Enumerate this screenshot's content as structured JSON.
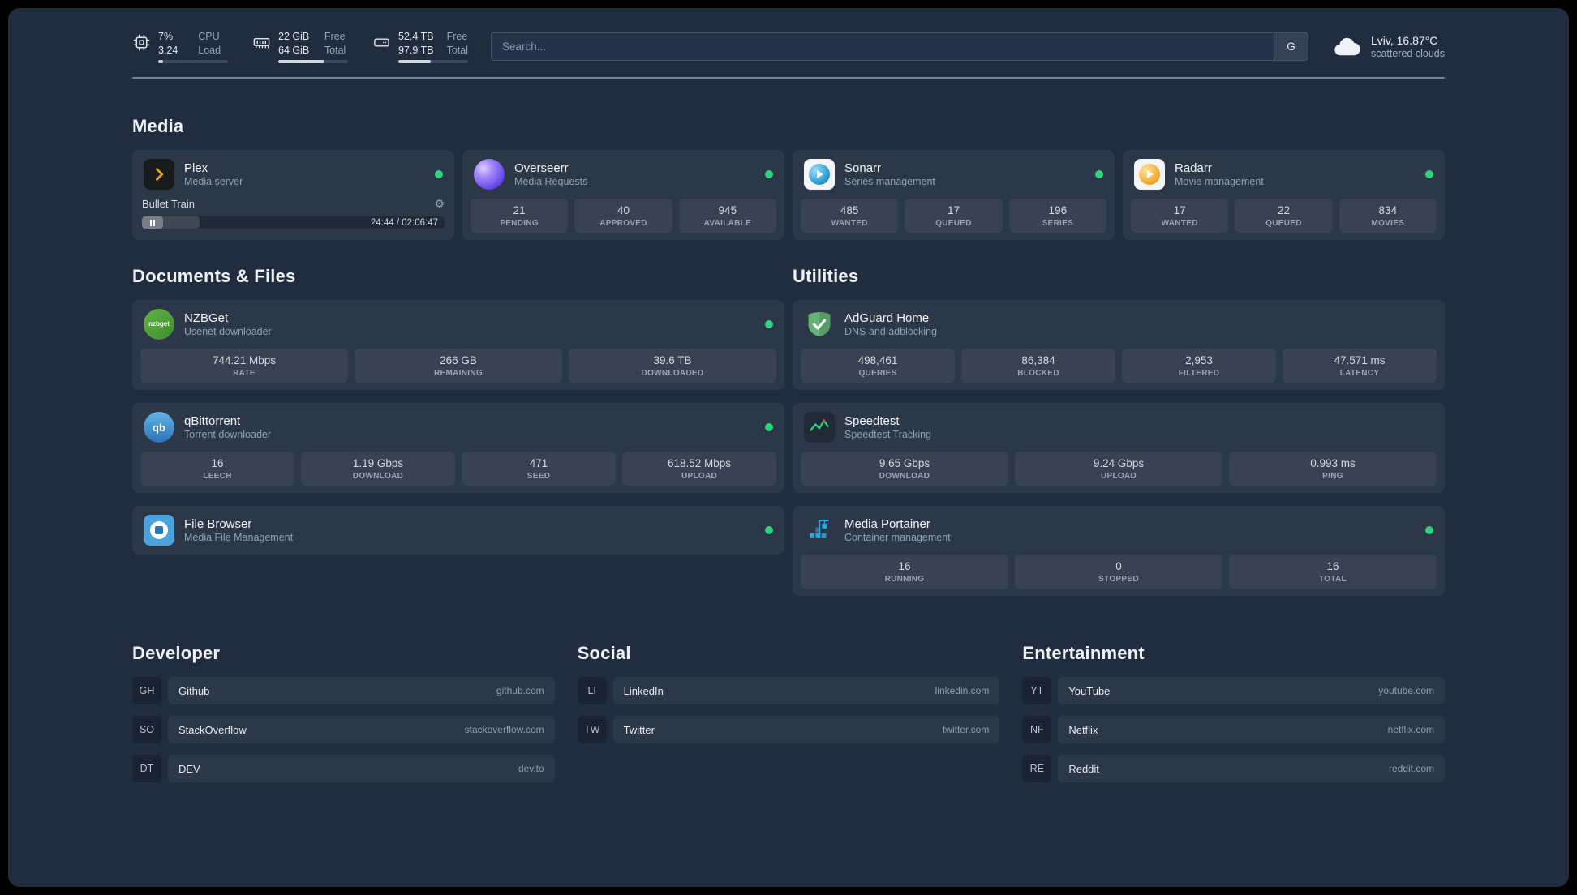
{
  "topbar": {
    "cpu": {
      "value1": "7%",
      "label1": "CPU",
      "value2": "3.24",
      "label2": "Load",
      "bar_style": "width:7%"
    },
    "memory": {
      "value1": "22 GiB",
      "label1": "Free",
      "value2": "64 GiB",
      "label2": "Total",
      "bar_style": "width:66%"
    },
    "disk": {
      "value1": "52.4 TB",
      "label1": "Free",
      "value2": "97.9 TB",
      "label2": "Total",
      "bar_style": "width:47%"
    },
    "search": {
      "placeholder": "Search...",
      "button_label": "G"
    },
    "weather": {
      "location": "Lviv, 16.87°C",
      "condition": "scattered clouds"
    }
  },
  "media": {
    "heading": "Media",
    "plex": {
      "name": "Plex",
      "desc": "Media server",
      "now_playing": "Bullet Train",
      "time": "24:44 / 02:06:47",
      "progress_style": "width:19%"
    },
    "overseerr": {
      "name": "Overseerr",
      "desc": "Media Requests",
      "stats": [
        {
          "value": "21",
          "label": "PENDING"
        },
        {
          "value": "40",
          "label": "APPROVED"
        },
        {
          "value": "945",
          "label": "AVAILABLE"
        }
      ]
    },
    "sonarr": {
      "name": "Sonarr",
      "desc": "Series management",
      "stats": [
        {
          "value": "485",
          "label": "WANTED"
        },
        {
          "value": "17",
          "label": "QUEUED"
        },
        {
          "value": "196",
          "label": "SERIES"
        }
      ]
    },
    "radarr": {
      "name": "Radarr",
      "desc": "Movie management",
      "stats": [
        {
          "value": "17",
          "label": "WANTED"
        },
        {
          "value": "22",
          "label": "QUEUED"
        },
        {
          "value": "834",
          "label": "MOVIES"
        }
      ]
    }
  },
  "documents": {
    "heading": "Documents & Files",
    "nzbget": {
      "name": "NZBGet",
      "desc": "Usenet downloader",
      "stats": [
        {
          "value": "744.21 Mbps",
          "label": "RATE"
        },
        {
          "value": "266 GB",
          "label": "REMAINING"
        },
        {
          "value": "39.6 TB",
          "label": "DOWNLOADED"
        }
      ]
    },
    "qbittorrent": {
      "name": "qBittorrent",
      "desc": "Torrent downloader",
      "stats": [
        {
          "value": "16",
          "label": "LEECH"
        },
        {
          "value": "1.19 Gbps",
          "label": "DOWNLOAD"
        },
        {
          "value": "471",
          "label": "SEED"
        },
        {
          "value": "618.52 Mbps",
          "label": "UPLOAD"
        }
      ]
    },
    "filebrowser": {
      "name": "File Browser",
      "desc": "Media File Management"
    }
  },
  "utilities": {
    "heading": "Utilities",
    "adguard": {
      "name": "AdGuard Home",
      "desc": "DNS and adblocking",
      "stats": [
        {
          "value": "498,461",
          "label": "QUERIES"
        },
        {
          "value": "86,384",
          "label": "BLOCKED"
        },
        {
          "value": "2,953",
          "label": "FILTERED"
        },
        {
          "value": "47.571 ms",
          "label": "LATENCY"
        }
      ]
    },
    "speedtest": {
      "name": "Speedtest",
      "desc": "Speedtest Tracking",
      "stats": [
        {
          "value": "9.65 Gbps",
          "label": "DOWNLOAD"
        },
        {
          "value": "9.24 Gbps",
          "label": "UPLOAD"
        },
        {
          "value": "0.993 ms",
          "label": "PING"
        }
      ]
    },
    "portainer": {
      "name": "Media Portainer",
      "desc": "Container management",
      "stats": [
        {
          "value": "16",
          "label": "RUNNING"
        },
        {
          "value": "0",
          "label": "STOPPED"
        },
        {
          "value": "16",
          "label": "TOTAL"
        }
      ]
    }
  },
  "bookmarks": {
    "developer": {
      "heading": "Developer",
      "items": [
        {
          "abbr": "GH",
          "name": "Github",
          "domain": "github.com"
        },
        {
          "abbr": "SO",
          "name": "StackOverflow",
          "domain": "stackoverflow.com"
        },
        {
          "abbr": "DT",
          "name": "DEV",
          "domain": "dev.to"
        }
      ]
    },
    "social": {
      "heading": "Social",
      "items": [
        {
          "abbr": "LI",
          "name": "LinkedIn",
          "domain": "linkedin.com"
        },
        {
          "abbr": "TW",
          "name": "Twitter",
          "domain": "twitter.com"
        }
      ]
    },
    "entertainment": {
      "heading": "Entertainment",
      "items": [
        {
          "abbr": "YT",
          "name": "YouTube",
          "domain": "youtube.com"
        },
        {
          "abbr": "NF",
          "name": "Netflix",
          "domain": "netflix.com"
        },
        {
          "abbr": "RE",
          "name": "Reddit",
          "domain": "reddit.com"
        }
      ]
    }
  },
  "icons": {
    "nzbget_label": "nzbget",
    "qbittorrent_label": "qb"
  },
  "colors": {
    "status_ok": "#2dd47e",
    "plex": "#e5a00d",
    "overseerr": "#6246ea",
    "sonarr": "#2596cf",
    "radarr": "#f0a52a",
    "nzbget": "#53a93e",
    "qbittorrent": "#3c86c8",
    "filebrowser": "#4aa3dd",
    "adguard": "#67b279",
    "speedtest": "#2fd180",
    "portainer": "#2fa8e1"
  }
}
